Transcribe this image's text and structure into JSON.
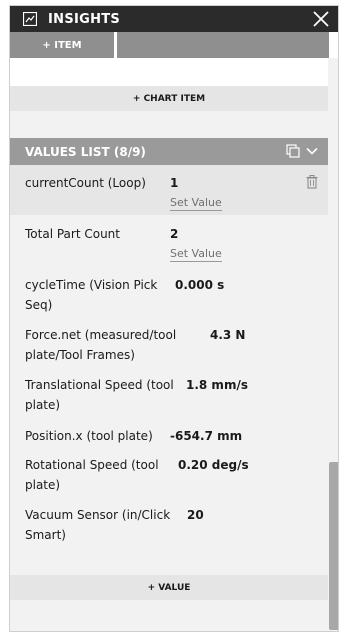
{
  "window": {
    "title": "INSIGHTS",
    "icon": "insights-chart-icon",
    "close_icon": "close-icon"
  },
  "toolbar": {
    "add_item": "+ ITEM"
  },
  "chart": {
    "add_chart_item": "+ CHART ITEM"
  },
  "values_list": {
    "title": "VALUES LIST (8/9)",
    "copy_icon": "copy-icon",
    "collapse_icon": "chevron-down-icon",
    "rows": [
      {
        "label": "currentCount (Loop)",
        "value": "1",
        "set_value": "Set Value"
      },
      {
        "label": "Total Part Count",
        "value": "2",
        "set_value": "Set Value"
      },
      {
        "label_line1": "cycleTime (Vision Pick",
        "label_line2": "Seq)",
        "value": "0.000 s"
      },
      {
        "label_line1": "Force.net (measured/tool",
        "label_line2": "plate/Tool Frames)",
        "value": "4.3 N"
      },
      {
        "label_line1": "Translational Speed (tool",
        "label_line2": "plate)",
        "value": "1.8 mm/s"
      },
      {
        "label": "Position.x (tool plate)",
        "value": "-654.7 mm"
      },
      {
        "label_line1": "Rotational Speed (tool",
        "label_line2": "plate)",
        "value": "0.20 deg/s"
      },
      {
        "label_line1": "Vacuum Sensor (in/Click",
        "label_line2": "Smart)",
        "value": "20"
      }
    ],
    "add_value": "+ VALUE"
  }
}
